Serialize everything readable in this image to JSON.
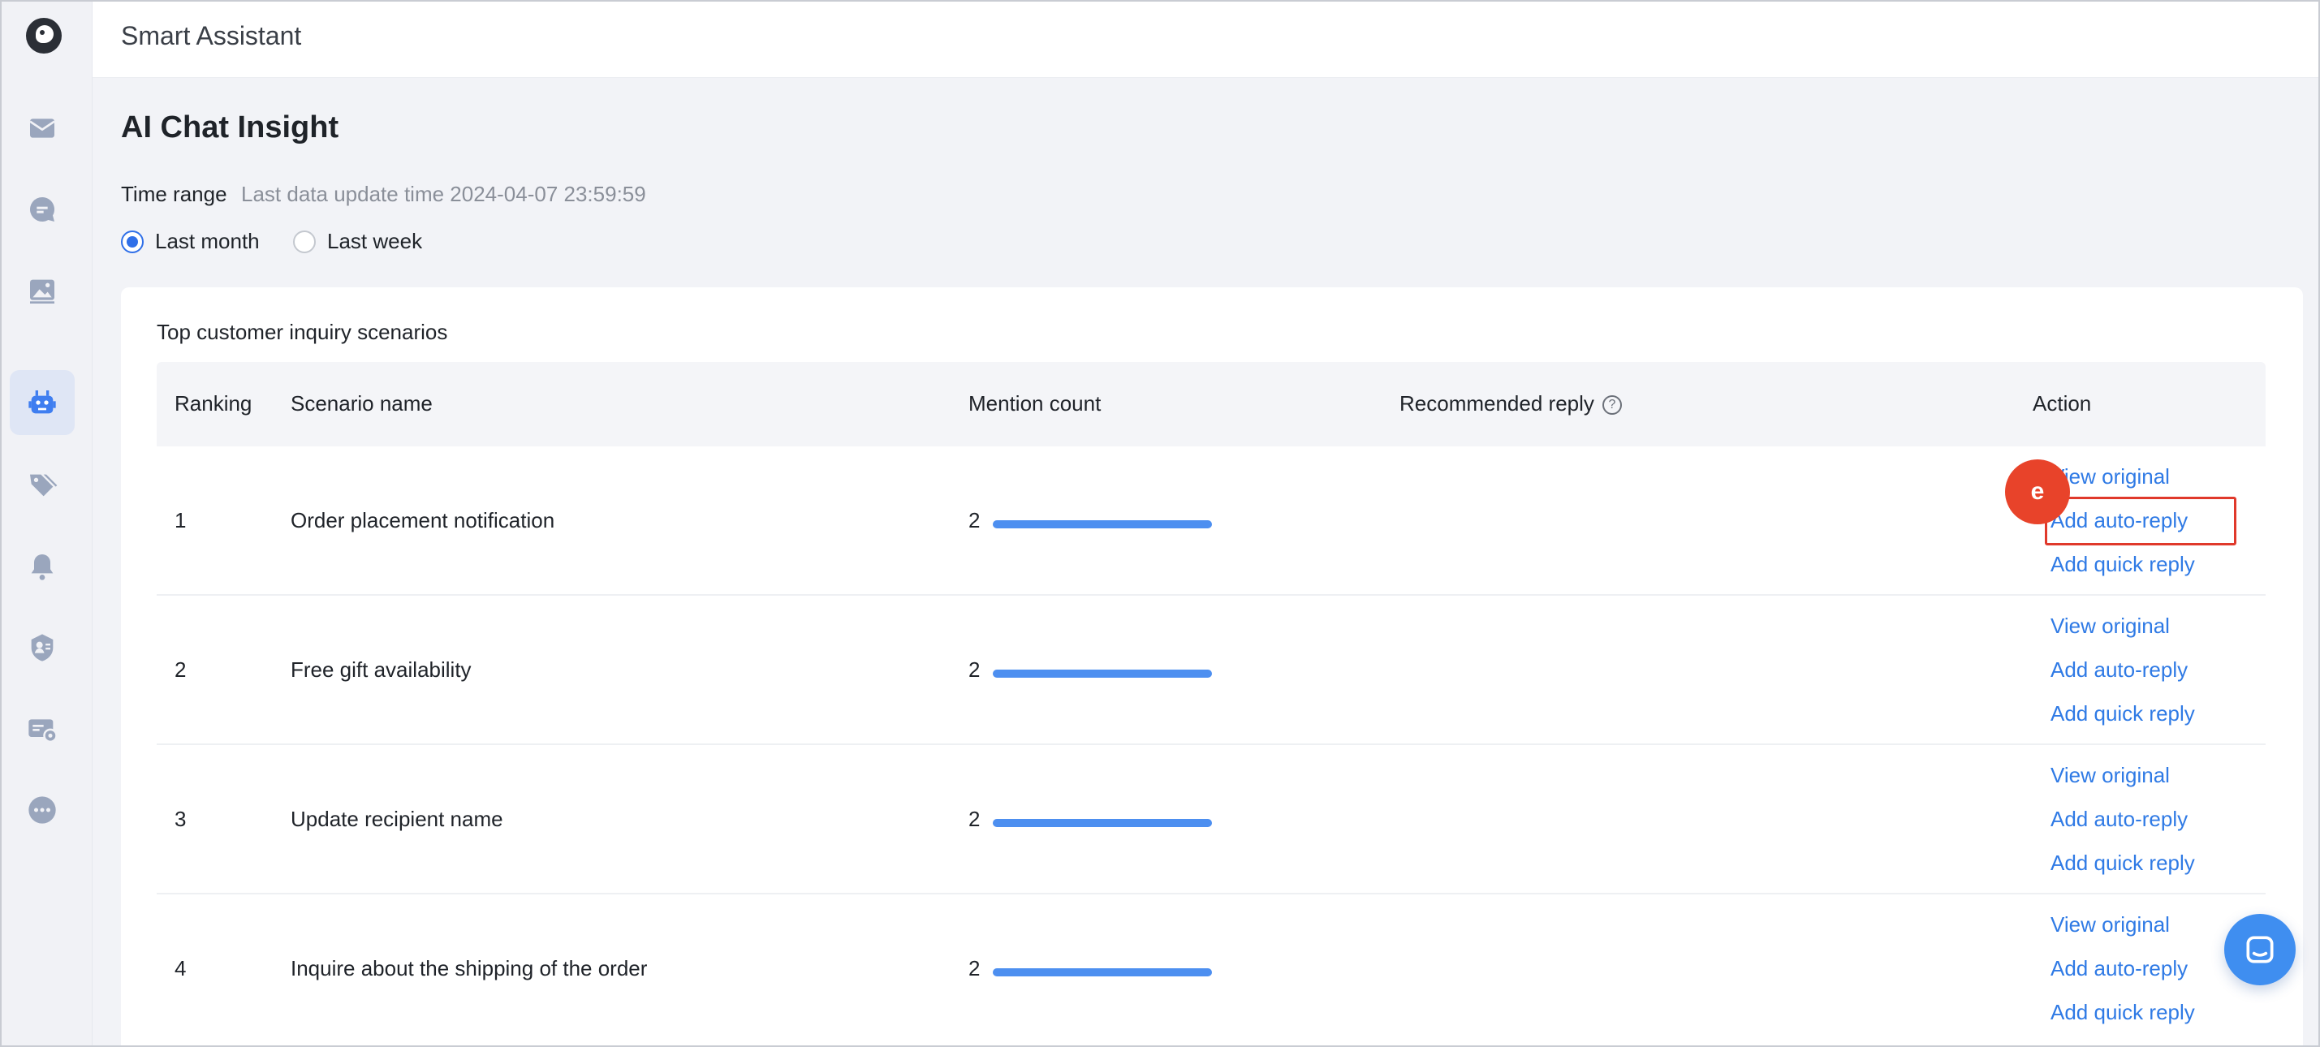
{
  "app": {
    "title": "Smart Assistant"
  },
  "page": {
    "title": "AI Chat Insight",
    "time_range_label": "Time range",
    "last_update": "Last data update time 2024-04-07 23:59:59",
    "range_options": [
      {
        "label": "Last month",
        "selected": true
      },
      {
        "label": "Last week",
        "selected": false
      }
    ]
  },
  "sidebar": {
    "items": [
      {
        "icon": "mail-icon"
      },
      {
        "icon": "chat-bubble-icon"
      },
      {
        "icon": "image-icon"
      },
      {
        "icon": "robot-icon",
        "active": true
      },
      {
        "icon": "tag-icon"
      },
      {
        "icon": "bell-icon"
      },
      {
        "icon": "user-shield-icon"
      },
      {
        "icon": "card-settings-icon"
      },
      {
        "icon": "more-icon"
      }
    ]
  },
  "section": {
    "title": "Top customer inquiry scenarios",
    "columns": [
      "Ranking",
      "Scenario name",
      "Mention count",
      "Recommended reply",
      "Action"
    ],
    "actions": [
      "View original",
      "Add auto-reply",
      "Add quick reply"
    ],
    "rows": [
      {
        "rank": "1",
        "scenario": "Order placement notification",
        "count": "2",
        "count_fraction": 1.0,
        "reply": ""
      },
      {
        "rank": "2",
        "scenario": "Free gift availability",
        "count": "2",
        "count_fraction": 1.0,
        "reply": ""
      },
      {
        "rank": "3",
        "scenario": "Update recipient name",
        "count": "2",
        "count_fraction": 1.0,
        "reply": ""
      },
      {
        "rank": "4",
        "scenario": "Inquire about the shipping of the order",
        "count": "2",
        "count_fraction": 1.0,
        "reply": ""
      }
    ]
  },
  "annotation": {
    "marker_label": "e",
    "accent": "#e8432a"
  },
  "colors": {
    "primary": "#2f7ae5",
    "bar": "#4d8ff0",
    "highlight": "#e0392b"
  }
}
